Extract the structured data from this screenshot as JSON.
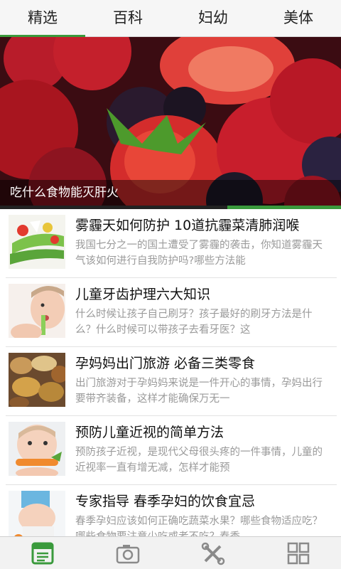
{
  "tabs": [
    {
      "label": "精选"
    },
    {
      "label": "百科"
    },
    {
      "label": "妇幼"
    },
    {
      "label": "美体"
    }
  ],
  "banner": {
    "caption": "吃什么食物能灭肝火"
  },
  "articles": [
    {
      "title": "雾霾天如何防护 10道抗霾菜清肺润喉",
      "desc": "我国七分之一的国土遭受了雾霾的袭击，你知道雾霾天气该如何进行自我防护吗?哪些方法能"
    },
    {
      "title": "儿童牙齿护理六大知识",
      "desc": "什么时候让孩子自己刷牙？孩子最好的刷牙方法是什么？什么时候可以带孩子去看牙医？这"
    },
    {
      "title": "孕妈妈出门旅游 必备三类零食",
      "desc": "出门旅游对于孕妈妈来说是一件开心的事情，孕妈出行要带齐装备，这样才能确保万无一"
    },
    {
      "title": "预防儿童近视的简单方法",
      "desc": "预防孩子近视，是现代父母很头疼的一件事情，儿童的近视率一直有增无减，怎样才能预"
    },
    {
      "title": "专家指导 春季孕妇的饮食宜忌",
      "desc": "春季孕妇应该如何正确吃蔬菜水果？哪些食物适应吃？哪些食物要注意少吃或者不吃？春季"
    }
  ],
  "icons": {
    "nav": [
      "news-icon",
      "camera-icon",
      "tools-icon",
      "grid-icon"
    ],
    "accent": "#3a9a3c"
  }
}
